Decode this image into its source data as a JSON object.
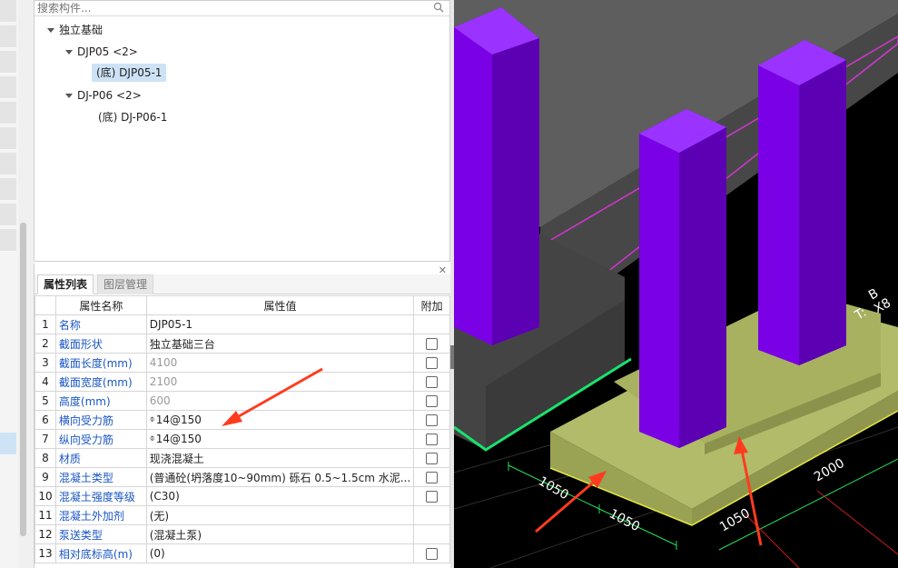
{
  "search": {
    "placeholder": "搜索构件..."
  },
  "tree": {
    "root": "独立基础",
    "groups": [
      {
        "label": "DJP05 <2>",
        "children": [
          "(底) DJP05-1"
        ]
      },
      {
        "label": "DJ-P06 <2>",
        "children": [
          "(底) DJ-P06-1"
        ]
      }
    ]
  },
  "tabs": [
    "属性列表",
    "图层管理"
  ],
  "table": {
    "headers": [
      "属性名称",
      "属性值",
      "附加"
    ],
    "rows": [
      {
        "no": "1",
        "name": "名称",
        "value": "DJP05-1",
        "has_box": false
      },
      {
        "no": "2",
        "name": "截面形状",
        "value": "独立基础三台",
        "has_box": true
      },
      {
        "no": "3",
        "name": "截面长度(mm)",
        "value": "4100",
        "has_box": true
      },
      {
        "no": "4",
        "name": "截面宽度(mm)",
        "value": "2100",
        "has_box": true
      },
      {
        "no": "5",
        "name": "高度(mm)",
        "value": "600",
        "has_box": true
      },
      {
        "no": "6",
        "name": "横向受力筋",
        "value": "14@150",
        "has_box": true
      },
      {
        "no": "7",
        "name": "纵向受力筋",
        "value": "14@150",
        "has_box": true
      },
      {
        "no": "8",
        "name": "材质",
        "value": "现浇混凝土",
        "has_box": true
      },
      {
        "no": "9",
        "name": "混凝土类型",
        "value": "(普通砼(坍落度10~90mm) 砾石 0.5~1.5cm 水泥...",
        "has_box": true
      },
      {
        "no": "10",
        "name": "混凝土强度等级",
        "value": "(C30)",
        "has_box": true
      },
      {
        "no": "11",
        "name": "混凝土外加剂",
        "value": "(无)",
        "has_box": false
      },
      {
        "no": "12",
        "name": "泵送类型",
        "value": "(混凝土泵)",
        "has_box": false
      },
      {
        "no": "13",
        "name": "相对底标高(m)",
        "value": "(0)",
        "has_box": true
      }
    ]
  },
  "viewport_dims": [
    "1050",
    "1050",
    "1050",
    "2000"
  ],
  "viewport_labels": [
    "B",
    "T:",
    "X8"
  ],
  "colors": {
    "column": "#7a00e6",
    "footing": "#a9b45f",
    "slab": "#595959",
    "arrow": "#ff3b1f"
  }
}
